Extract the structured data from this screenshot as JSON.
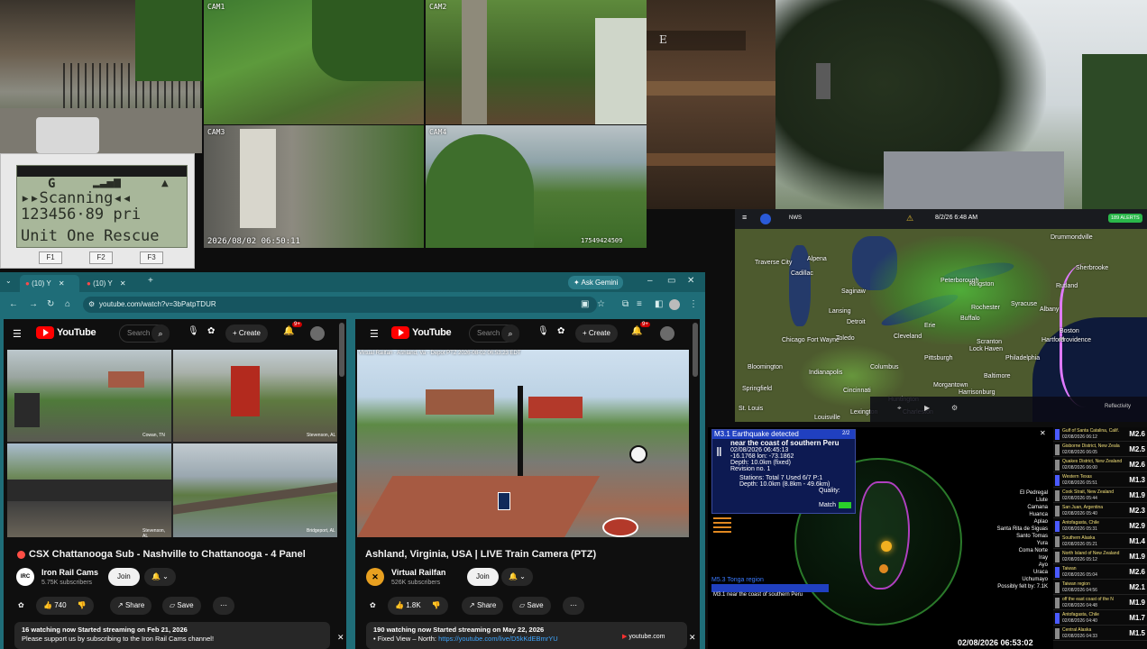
{
  "cams": {
    "cam1": "CAM1",
    "cam2": "CAM2",
    "cam3": "CAM3",
    "cam4": "CAM4",
    "timestamp_left": "2026/08/02 06:50:11",
    "timestamp_right": "17549424509",
    "overlay_letter": "E"
  },
  "scanner": {
    "mode_letter": "G",
    "line1": "▸▸Scanning◂◂",
    "line2": "123456·89  pri",
    "line3": "Unit One Rescue",
    "buttons": [
      "F1",
      "F2",
      "F3"
    ]
  },
  "browser": {
    "tabs": [
      {
        "label": "(10) Y"
      },
      {
        "label": "(10) Y"
      }
    ],
    "ask_gemini": "Ask Gemini",
    "url": "youtube.com/watch?v=3bPatpTDUR",
    "left": {
      "brand": "YouTube",
      "search_placeholder": "Search",
      "create": "Create",
      "notif_count": "9+",
      "tiles": [
        "Cowan, TN",
        "Stevenson, AL",
        "Stevenson, AL",
        "Bridgeport, AL"
      ],
      "title": "CSX Chattanooga Sub - Nashville to Chattanooga - 4 Panel",
      "channel": "Iron Rail Cams",
      "subs": "5.75K subscribers",
      "join": "Join",
      "likes": "740",
      "share": "Share",
      "save": "Save",
      "desc_line1": "16 watching now  Started streaming on Feb 21, 2026",
      "desc_line2": "Please support us by subscribing to the Iron Rail Cams channel!"
    },
    "right": {
      "brand": "YouTube",
      "search_placeholder": "Search",
      "create": "Create",
      "notif_count": "9+",
      "overlay": "Virtual Railfan - Ashland, Va - Depot PTZ  2026-08-02 06:53:23 EDT",
      "title": "Ashland, Virginia, USA | LIVE Train Camera (PTZ)",
      "channel": "Virtual Railfan",
      "subs": "526K subscribers",
      "join": "Join",
      "likes": "1.8K",
      "share": "Share",
      "save": "Save",
      "desc_line1": "190 watching now  Started streaming on May 22, 2026",
      "desc_prefix": "• Fixed View – North: ",
      "desc_link": "https://youtube.com/live/D5kKdEBmrYU"
    },
    "status_host": "youtube.com"
  },
  "radar": {
    "datetime": "8/2/26 6:48 AM",
    "alerts": "189 ALERTS",
    "cities": [
      {
        "name": "Traverse City"
      },
      {
        "name": "Alpena"
      },
      {
        "name": "Cadillac"
      },
      {
        "name": "Saginaw"
      },
      {
        "name": "Lansing"
      },
      {
        "name": "Detroit"
      },
      {
        "name": "Toledo"
      },
      {
        "name": "Cleveland"
      },
      {
        "name": "Erie"
      },
      {
        "name": "Buffalo"
      },
      {
        "name": "Rochester"
      },
      {
        "name": "Syracuse"
      },
      {
        "name": "Albany"
      },
      {
        "name": "Boston"
      },
      {
        "name": "Providence"
      },
      {
        "name": "Hartford"
      },
      {
        "name": "Scranton"
      },
      {
        "name": "Pittsburgh"
      },
      {
        "name": "Columbus"
      },
      {
        "name": "Indianapolis"
      },
      {
        "name": "Bloomington"
      },
      {
        "name": "Springfield"
      },
      {
        "name": "Louisville"
      },
      {
        "name": "Lexington"
      },
      {
        "name": "Charleston"
      },
      {
        "name": "Baltimore"
      },
      {
        "name": "Philadelphia"
      },
      {
        "name": "Rutland"
      },
      {
        "name": "Drummondville"
      },
      {
        "name": "Sherbrooke"
      },
      {
        "name": "Kingston"
      },
      {
        "name": "Peterborough"
      },
      {
        "name": "Lock Haven"
      },
      {
        "name": "Morgantown"
      },
      {
        "name": "Cincinnati"
      },
      {
        "name": "Huntington"
      },
      {
        "name": "Harrisonburg"
      },
      {
        "name": "St. Louis"
      },
      {
        "name": "Chicago"
      },
      {
        "name": "Fort Wayne"
      }
    ],
    "reflectivity": "Reflectivity"
  },
  "quake": {
    "header_title": "M3.1 Earthquake detected",
    "count": "2/2",
    "location": "near the coast of southern Peru",
    "time": "02/08/2026 06:45:13",
    "lat": "-16.1768 lon: -73.1862",
    "depth": "Depth: 10.0km (fixed)",
    "revision": "Revision no. 1",
    "stations": "Stations: Total 7 Used 6/7 P:1",
    "depth2": "Depth: 10.0km (8.8km - 49.6km)",
    "quality": "Quality:",
    "match": "Match",
    "alert1": "M5.3 Tonga region",
    "alert2": "M3.1 near the coast of southern Peru",
    "bottom_time": "02/08/2026 06:53:02",
    "places": [
      "El Pedregal",
      "Llute",
      "Camana",
      "Huanca",
      "Aplao",
      "Santa Rita de Siguas",
      "Santo Tomas",
      "Yura",
      "Coma Norte",
      "Iray",
      "Ayo",
      "Uraca",
      "Uchumayo",
      "Possibly felt by: 7.1K"
    ],
    "events": [
      {
        "place": "Gulf of Santa Catalina, Calif.",
        "time": "02/08/2026 06:12",
        "mag": "M2.6"
      },
      {
        "place": "Gisborne District, New Zeala",
        "time": "02/08/2026 06:05",
        "mag": "M2.5"
      },
      {
        "place": "Quakes District, New Zealand",
        "time": "02/08/2026 06:00",
        "mag": "M2.6"
      },
      {
        "place": "Western Texas",
        "time": "02/08/2026 05:51",
        "mag": "M1.3"
      },
      {
        "place": "Cook Strait, New Zealand",
        "time": "02/08/2026 05:44",
        "mag": "M1.9"
      },
      {
        "place": "San Juan, Argentina",
        "time": "02/08/2026 05:40",
        "mag": "M2.3"
      },
      {
        "place": "Antofagasta, Chile",
        "time": "02/08/2026 05:31",
        "mag": "M2.9"
      },
      {
        "place": "Southern Alaska",
        "time": "02/08/2026 05:21",
        "mag": "M1.4"
      },
      {
        "place": "North Island of New Zealand",
        "time": "02/08/2026 05:12",
        "mag": "M1.9"
      },
      {
        "place": "Taiwan",
        "time": "02/08/2026 05:04",
        "mag": "M2.6"
      },
      {
        "place": "Taiwan region",
        "time": "02/08/2026 04:56",
        "mag": "M2.1"
      },
      {
        "place": "off the east coast of the N",
        "time": "02/08/2026 04:48",
        "mag": "M1.9"
      },
      {
        "place": "Antofagasta, Chile",
        "time": "02/08/2026 04:40",
        "mag": "M1.7"
      },
      {
        "place": "Central Alaska",
        "time": "02/08/2026 04:33",
        "mag": "M1.5"
      }
    ]
  }
}
